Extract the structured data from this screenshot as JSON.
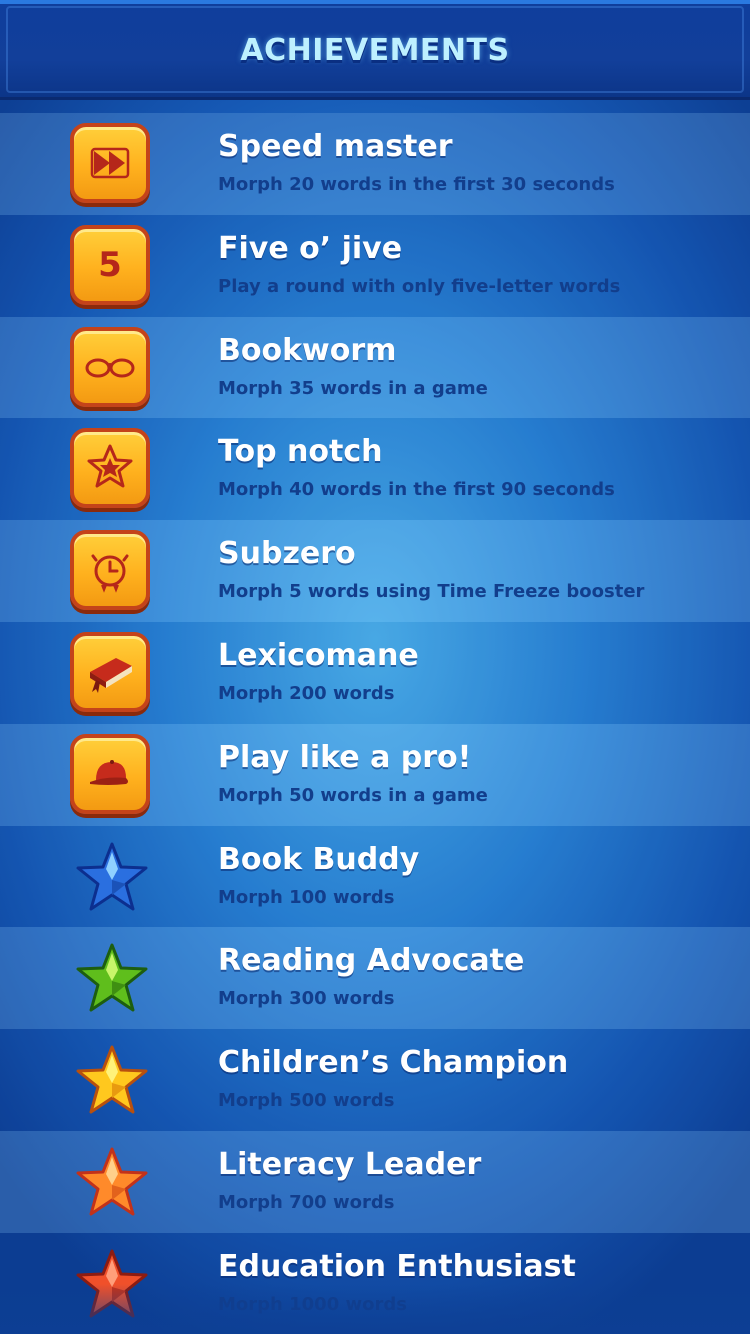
{
  "header": {
    "title": "ACHIEVEMENTS"
  },
  "colors": {
    "tile_fill": "#ffb11e",
    "tile_border": "#c4431a",
    "icon_red": "#b5271a",
    "description": "#123e8c"
  },
  "achievements": [
    {
      "name": "Speed master",
      "description": "Morph 20 words in the first 30 seconds",
      "icon": "fast-forward-icon"
    },
    {
      "name": "Five o’ jive",
      "description": "Play a round with only five-letter words",
      "icon": "five-icon",
      "icon_text": "5"
    },
    {
      "name": "Bookworm",
      "description": "Morph 35  words in a game",
      "icon": "glasses-icon"
    },
    {
      "name": "Top notch",
      "description": "Morph 40 words in the first 90 seconds",
      "icon": "star-badge-icon"
    },
    {
      "name": "Subzero",
      "description": "Morph 5 words using Time Freeze booster",
      "icon": "frozen-clock-icon"
    },
    {
      "name": "Lexicomane",
      "description": "Morph 200 words",
      "icon": "book-icon"
    },
    {
      "name": "Play like a pro!",
      "description": "Morph 50 words in a game",
      "icon": "cap-icon"
    },
    {
      "name": "Book Buddy",
      "description": "Morph 100 words",
      "icon": "blue-star-icon"
    },
    {
      "name": "Reading Advocate",
      "description": "Morph 300 words",
      "icon": "green-star-icon"
    },
    {
      "name": "Children’s Champion",
      "description": "Morph 500 words",
      "icon": "yellow-star-icon"
    },
    {
      "name": "Literacy Leader",
      "description": "Morph 700 words",
      "icon": "orange-star-icon"
    },
    {
      "name": "Education Enthusiast",
      "description": "Morph 1000 words",
      "icon": "red-star-icon"
    }
  ]
}
